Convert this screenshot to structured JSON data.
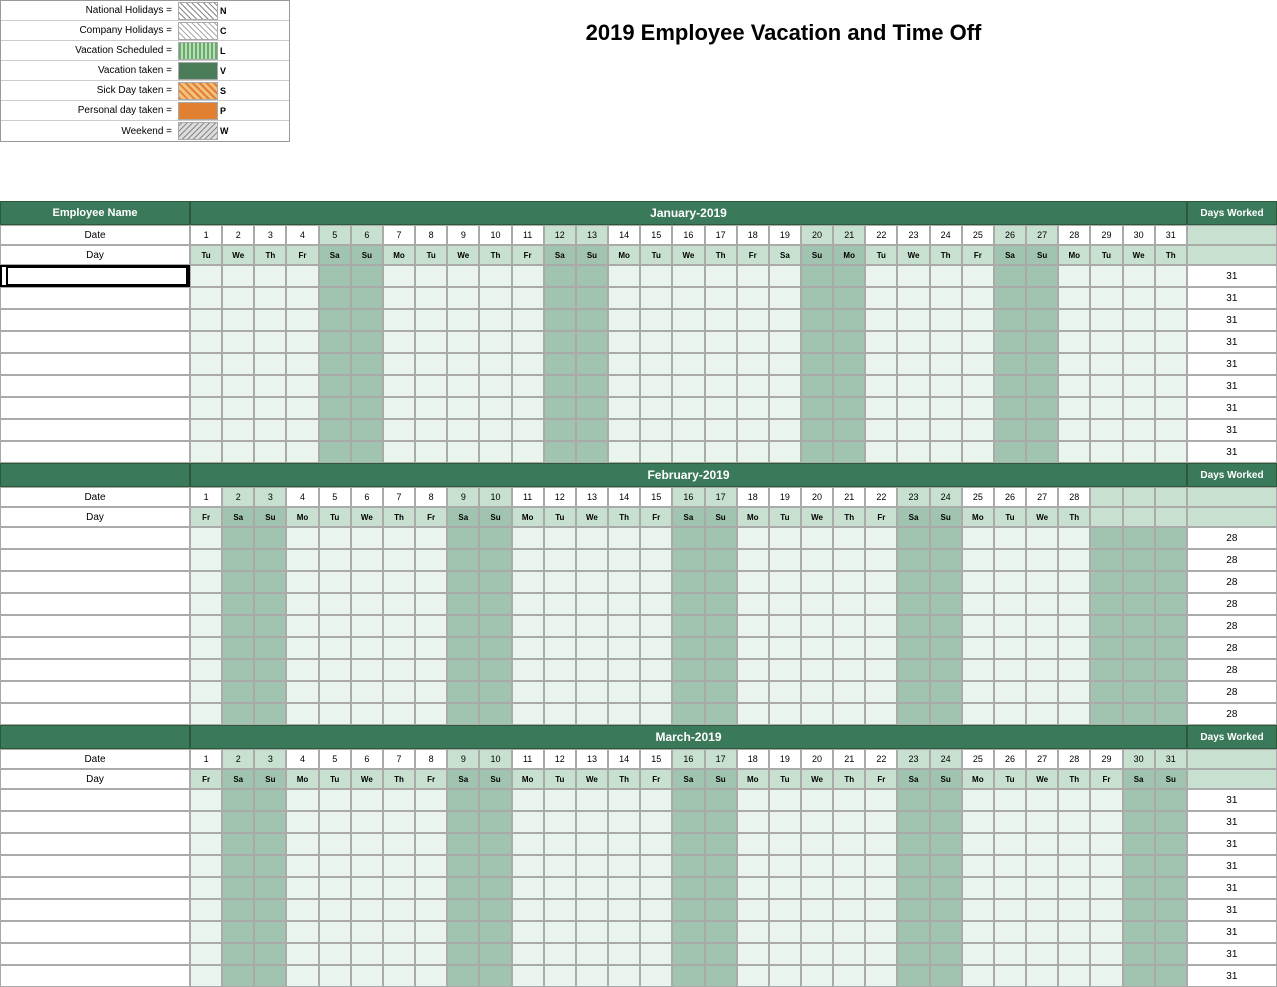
{
  "title": "2019 Employee Vacation and Time Off",
  "legend": {
    "items": [
      {
        "label": "National Holidays =",
        "code": "N",
        "swatchClass": "swatch-national"
      },
      {
        "label": "Company Holidays =",
        "code": "C",
        "swatchClass": "swatch-company"
      },
      {
        "label": "Vacation Scheduled =",
        "code": "L",
        "swatchClass": "swatch-vac-sched"
      },
      {
        "label": "Vacation taken =",
        "code": "V",
        "swatchClass": "swatch-vac-taken"
      },
      {
        "label": "Sick Day taken =",
        "code": "S",
        "swatchClass": "swatch-sick"
      },
      {
        "label": "Personal day taken =",
        "code": "P",
        "swatchClass": "swatch-personal"
      },
      {
        "label": "Weekend =",
        "code": "W",
        "swatchClass": "swatch-weekend"
      }
    ]
  },
  "headers": {
    "employee_name": "Employee Name",
    "date": "Date",
    "day": "Day",
    "days_worked": "Days Worked"
  },
  "months": [
    {
      "name": "January-2019",
      "days": 31,
      "day_names": [
        "Tu",
        "We",
        "Th",
        "Fr",
        "Sa",
        "Su",
        "Mo",
        "Tu",
        "We",
        "Th",
        "Fr",
        "Sa",
        "Su",
        "Mo",
        "Tu",
        "We",
        "Th",
        "Fr",
        "Sa",
        "Su",
        "Mo",
        "Tu",
        "We",
        "Th",
        "Fr",
        "Sa",
        "Su",
        "Mo",
        "Tu",
        "We",
        "Th"
      ],
      "weekend_indices": [
        4,
        5,
        11,
        12,
        19,
        20,
        25,
        26
      ],
      "days_worked": 31
    },
    {
      "name": "February-2019",
      "days": 28,
      "day_names": [
        "Fr",
        "Sa",
        "Su",
        "Mo",
        "Tu",
        "We",
        "Th",
        "Fr",
        "Sa",
        "Su",
        "Mo",
        "Tu",
        "We",
        "Th",
        "Fr",
        "Sa",
        "Su",
        "Mo",
        "Tu",
        "We",
        "Th",
        "Fr",
        "Sa",
        "Su",
        "Mo",
        "Tu",
        "We",
        "Th"
      ],
      "weekend_indices": [
        1,
        2,
        8,
        9,
        15,
        16,
        22,
        23
      ],
      "days_worked": 28
    },
    {
      "name": "March-2019",
      "days": 31,
      "day_names": [
        "Fr",
        "Sa",
        "Su",
        "Mo",
        "Tu",
        "We",
        "Th",
        "Fr",
        "Sa",
        "Su",
        "Mo",
        "Tu",
        "We",
        "Th",
        "Fr",
        "Sa",
        "Su",
        "Mo",
        "Tu",
        "We",
        "Th",
        "Fr",
        "Sa",
        "Su",
        "Mo",
        "Tu",
        "We",
        "Th",
        "Fr",
        "Sa",
        "Su"
      ],
      "weekend_indices": [
        1,
        2,
        8,
        9,
        15,
        16,
        22,
        23,
        29,
        30
      ],
      "days_worked": 31
    }
  ],
  "employees": [
    "",
    "",
    "",
    "",
    "",
    "",
    "",
    "",
    ""
  ]
}
